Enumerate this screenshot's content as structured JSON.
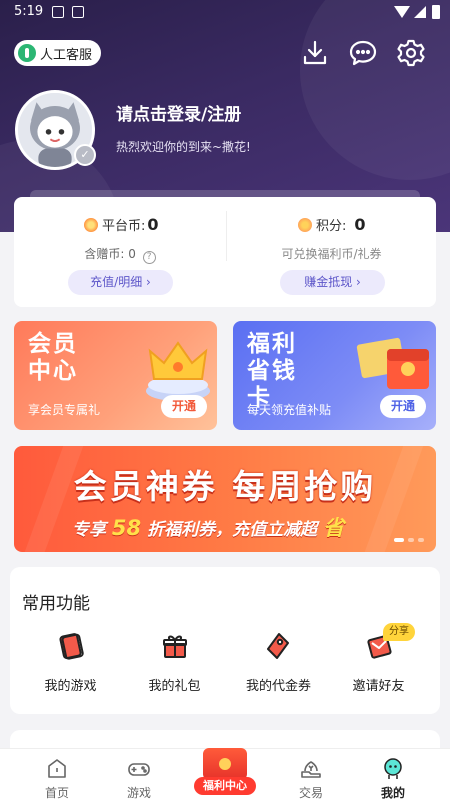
{
  "status_bar": {
    "time": "5:19"
  },
  "header": {
    "service_label": "人工客服",
    "login_title": "请点击登录/注册",
    "welcome_text": "热烈欢迎你的到来~撒花!"
  },
  "wallet": {
    "platform_coin_label": "平台币:",
    "platform_coin_value": "0",
    "points_label": "积分:",
    "points_value": "0",
    "gift_coin_label": "含赠币:",
    "gift_coin_value": "0",
    "exchange_text": "可兑换福利币/礼券",
    "recharge_button": "充值/明细 ›",
    "earn_button": "赚金抵现 ›"
  },
  "promos": {
    "vip": {
      "title": "会员中心",
      "subtitle": "享会员专属礼",
      "button": "开通"
    },
    "fuli": {
      "title": "福利省钱卡",
      "subtitle": "每天领充值补贴",
      "button": "开通"
    }
  },
  "banner": {
    "line1": "会员神券 每周抢购",
    "line2_prefix": "专享",
    "line2_number": "58",
    "line2_middle": "折福利券，充值立减超",
    "line2_highlight": "省"
  },
  "functions": {
    "title": "常用功能",
    "share_tag": "分享",
    "items": [
      {
        "label": "我的游戏",
        "icon": "game-card-icon"
      },
      {
        "label": "我的礼包",
        "icon": "gift-icon"
      },
      {
        "label": "我的代金券",
        "icon": "coupon-tag-icon"
      },
      {
        "label": "邀请好友",
        "icon": "invite-envelope-icon"
      }
    ]
  },
  "tabbar": {
    "tabs": [
      {
        "label": "首页",
        "icon": "home-icon"
      },
      {
        "label": "游戏",
        "icon": "gamepad-icon"
      },
      {
        "label": "福利中心",
        "icon": "red-envelope-icon"
      },
      {
        "label": "交易",
        "icon": "trade-icon"
      },
      {
        "label": "我的",
        "icon": "profile-icon"
      }
    ],
    "active": "我的"
  },
  "colors": {
    "header_dark": "#2a1f4a",
    "accent_purple": "#5d56c9",
    "vip_orange": "#ff7a5a",
    "fuli_blue": "#5a6ff2",
    "banner_red": "#ff5a3c",
    "icon_red": "#f25a4a"
  }
}
